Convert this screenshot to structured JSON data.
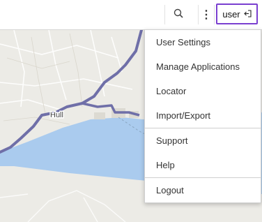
{
  "topbar": {
    "search_icon": "search-icon",
    "more_icon": "more-vertical-icon",
    "more_glyph": "⋮",
    "user_label": "user",
    "user_icon": "sign-out-icon",
    "highlight_color": "#7a3fd0"
  },
  "map": {
    "place_label": "Hull",
    "water_color": "#aacbee",
    "land_color": "#ecebe6",
    "route_color": "#6f6fa8"
  },
  "menu": {
    "items": [
      {
        "label": "User Settings"
      },
      {
        "label": "Manage Applications"
      },
      {
        "label": "Locator"
      },
      {
        "label": "Import/Export"
      },
      {
        "label": "Support"
      },
      {
        "label": "Help"
      },
      {
        "label": "Logout"
      }
    ]
  }
}
